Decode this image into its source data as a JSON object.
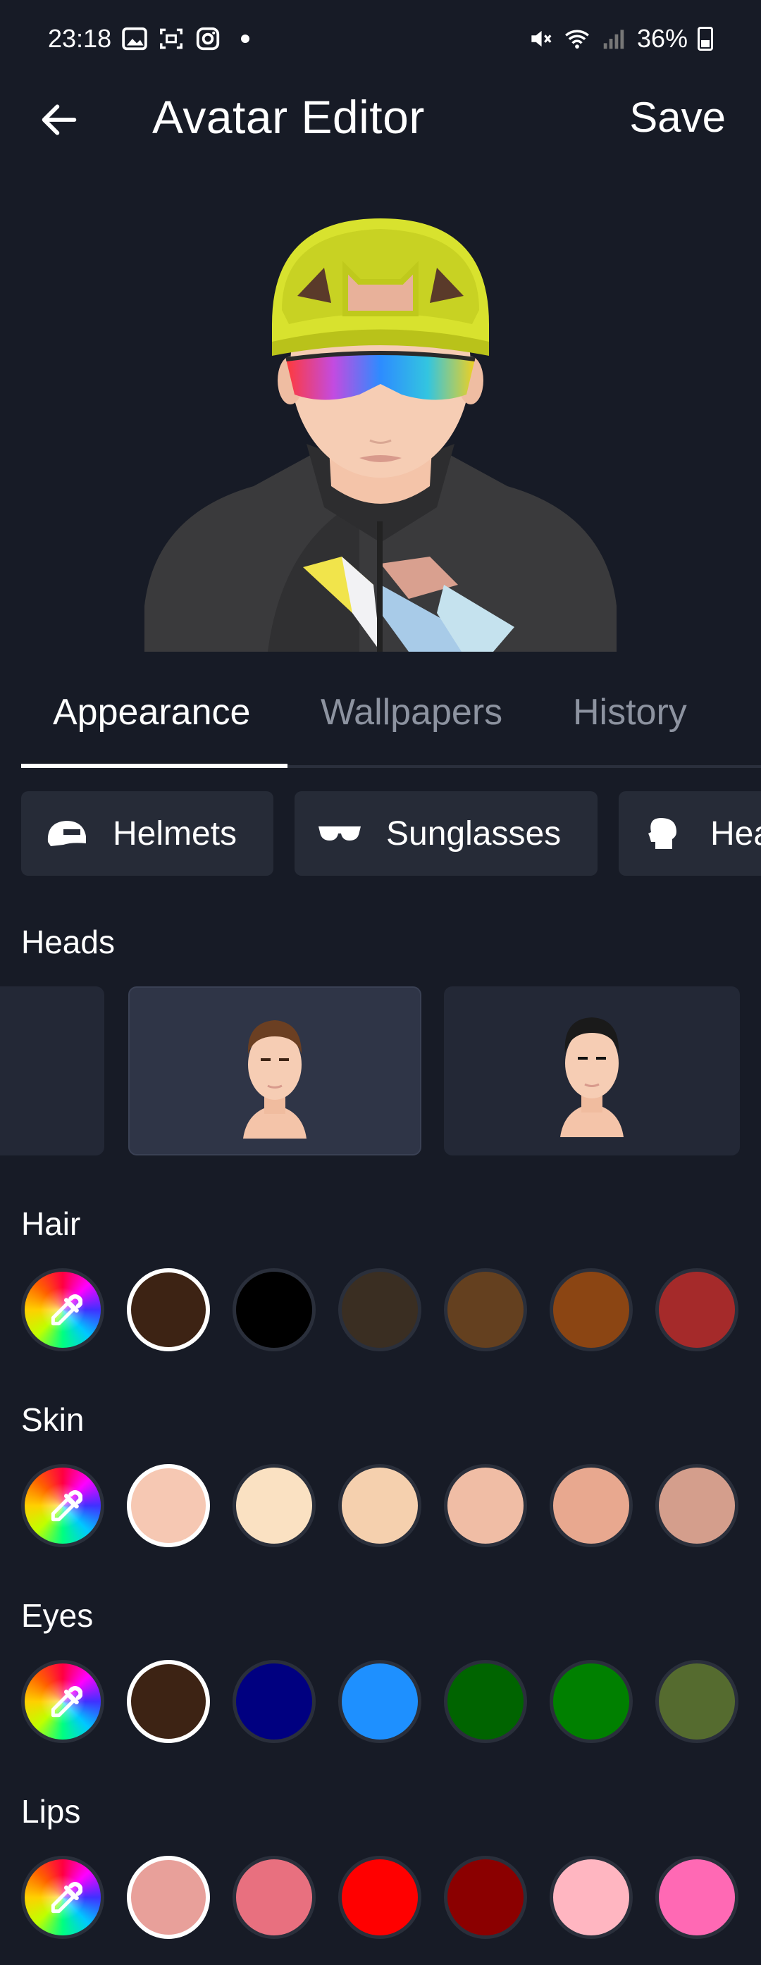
{
  "status_bar": {
    "time": "23:18",
    "battery": "36%"
  },
  "app_bar": {
    "title": "Avatar Editor",
    "save_label": "Save"
  },
  "tabs": [
    {
      "label": "Appearance",
      "active": true
    },
    {
      "label": "Wallpapers",
      "active": false
    },
    {
      "label": "History",
      "active": false
    }
  ],
  "chips": [
    {
      "label": "Helmets",
      "icon": "helmet-icon"
    },
    {
      "label": "Sunglasses",
      "icon": "sunglasses-icon"
    },
    {
      "label": "Hea",
      "icon": "head-icon"
    }
  ],
  "sections": {
    "heads": "Heads",
    "hair": "Hair",
    "skin": "Skin",
    "eyes": "Eyes",
    "lips": "Lips"
  },
  "heads": {
    "selected_index": 1
  },
  "swatches": {
    "hair": [
      "#3d2314",
      "#000000",
      "#3a2e22",
      "#64401f",
      "#8b4513",
      "#a52a2a"
    ],
    "skin": [
      "#f6c8b3",
      "#fae1c2",
      "#f5d0ae",
      "#f0bda5",
      "#e8a88f",
      "#d49e8c"
    ],
    "eyes": [
      "#3d2314",
      "#000080",
      "#1e90ff",
      "#006400",
      "#008000",
      "#556b2f"
    ],
    "lips": [
      "#e8a09a",
      "#e8707f",
      "#ff0000",
      "#8b0000",
      "#ffb6c1",
      "#ff69b4"
    ]
  },
  "colors": {
    "background": "#171b26",
    "card": "#262b37",
    "inactive_text": "#8d93a0"
  }
}
